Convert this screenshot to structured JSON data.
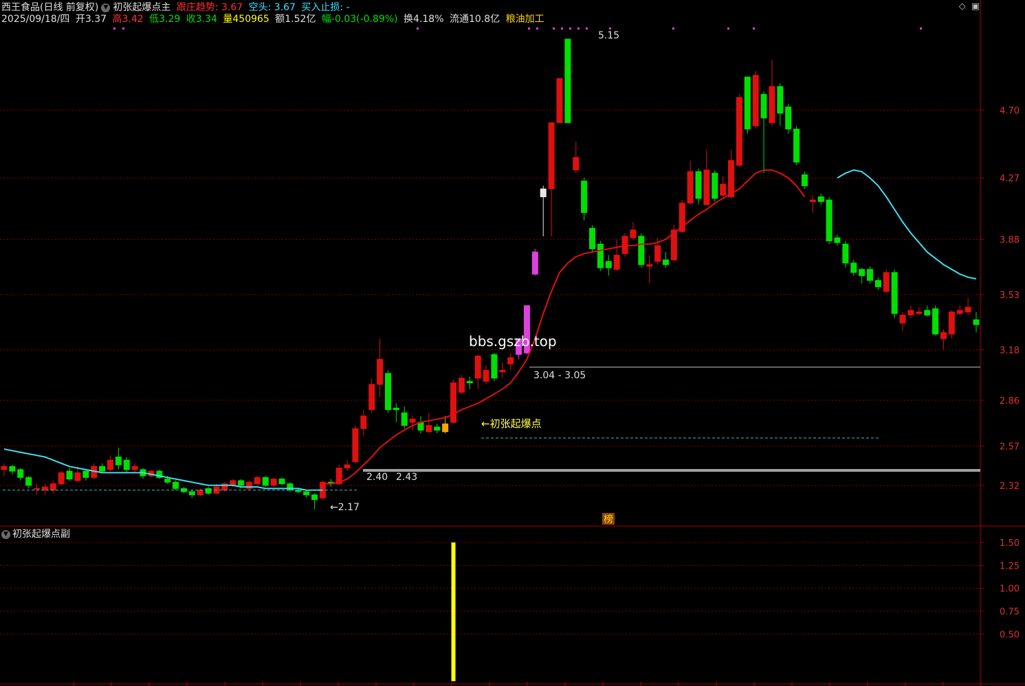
{
  "header": {
    "stock": "西王食品(日线 前复权)",
    "indicator": "初张起爆点主",
    "trend_label": "跟庄趋势: 3.67",
    "short_label": "空头: 3.67",
    "stop_label": "买入止损: -",
    "date": "2025/09/18/四",
    "open": "开3.37",
    "high": "高3.42",
    "low": "低3.29",
    "close": "收3.34",
    "volume": "量450965",
    "amount": "额1.52亿",
    "change": "幅-0.03(-0.89%)",
    "turnover": "换4.18%",
    "float": "流通10.8亿",
    "sector": "粮油加工"
  },
  "sub_panel": {
    "title": "初张起爆点副"
  },
  "colors": {
    "up": "#e01010",
    "down": "#00e000",
    "ma_cyan": "#40e0f0",
    "ma_red": "#e01010",
    "grid": "#8b0000",
    "signal": "#ffff00"
  },
  "chart_data": [
    {
      "type": "candlestick",
      "y_ticks": [
        "4.70",
        "4.27",
        "3.88",
        "3.53",
        "3.18",
        "2.86",
        "2.57",
        "2.32"
      ],
      "ylim": [
        2.05,
        5.25
      ],
      "annotations": {
        "watermark_site": "bbs.gszb.top",
        "peak_label": "5.15",
        "low_label": "←2.17",
        "range_label": "3.04 - 3.05",
        "band_left": "2.40",
        "band_right": "2.43",
        "signal_label": "←初张起爆点",
        "badge": "榜"
      },
      "candles": [
        {
          "o": 2.42,
          "c": 2.44,
          "h": 2.46,
          "l": 2.38
        },
        {
          "o": 2.44,
          "c": 2.41,
          "h": 2.45,
          "l": 2.39
        },
        {
          "o": 2.42,
          "c": 2.37,
          "h": 2.43,
          "l": 2.35
        },
        {
          "o": 2.37,
          "c": 2.32,
          "h": 2.38,
          "l": 2.3
        },
        {
          "o": 2.3,
          "c": 2.3,
          "h": 2.33,
          "l": 2.26
        },
        {
          "o": 2.29,
          "c": 2.31,
          "h": 2.33,
          "l": 2.26
        },
        {
          "o": 2.29,
          "c": 2.33,
          "h": 2.35,
          "l": 2.27
        },
        {
          "o": 2.33,
          "c": 2.4,
          "h": 2.41,
          "l": 2.32
        },
        {
          "o": 2.41,
          "c": 2.36,
          "h": 2.43,
          "l": 2.35
        },
        {
          "o": 2.35,
          "c": 2.4,
          "h": 2.44,
          "l": 2.34
        },
        {
          "o": 2.41,
          "c": 2.37,
          "h": 2.42,
          "l": 2.35
        },
        {
          "o": 2.37,
          "c": 2.44,
          "h": 2.46,
          "l": 2.36
        },
        {
          "o": 2.44,
          "c": 2.41,
          "h": 2.46,
          "l": 2.4
        },
        {
          "o": 2.42,
          "c": 2.48,
          "h": 2.51,
          "l": 2.41
        },
        {
          "o": 2.5,
          "c": 2.45,
          "h": 2.56,
          "l": 2.42
        },
        {
          "o": 2.48,
          "c": 2.42,
          "h": 2.5,
          "l": 2.4
        },
        {
          "o": 2.42,
          "c": 2.44,
          "h": 2.46,
          "l": 2.4
        },
        {
          "o": 2.42,
          "c": 2.38,
          "h": 2.43,
          "l": 2.36
        },
        {
          "o": 2.38,
          "c": 2.41,
          "h": 2.42,
          "l": 2.37
        },
        {
          "o": 2.41,
          "c": 2.37,
          "h": 2.42,
          "l": 2.36
        },
        {
          "o": 2.36,
          "c": 2.34,
          "h": 2.38,
          "l": 2.33
        },
        {
          "o": 2.34,
          "c": 2.3,
          "h": 2.35,
          "l": 2.29
        },
        {
          "o": 2.3,
          "c": 2.28,
          "h": 2.31,
          "l": 2.27
        },
        {
          "o": 2.28,
          "c": 2.26,
          "h": 2.29,
          "l": 2.24
        },
        {
          "o": 2.26,
          "c": 2.29,
          "h": 2.3,
          "l": 2.25
        },
        {
          "o": 2.3,
          "c": 2.27,
          "h": 2.31,
          "l": 2.26
        },
        {
          "o": 2.27,
          "c": 2.31,
          "h": 2.33,
          "l": 2.26
        },
        {
          "o": 2.29,
          "c": 2.33,
          "h": 2.34,
          "l": 2.28
        },
        {
          "o": 2.32,
          "c": 2.35,
          "h": 2.36,
          "l": 2.31
        },
        {
          "o": 2.35,
          "c": 2.32,
          "h": 2.36,
          "l": 2.3
        },
        {
          "o": 2.3,
          "c": 2.34,
          "h": 2.35,
          "l": 2.29
        },
        {
          "o": 2.33,
          "c": 2.37,
          "h": 2.38,
          "l": 2.32
        },
        {
          "o": 2.37,
          "c": 2.32,
          "h": 2.38,
          "l": 2.31
        },
        {
          "o": 2.32,
          "c": 2.36,
          "h": 2.37,
          "l": 2.31
        },
        {
          "o": 2.36,
          "c": 2.33,
          "h": 2.37,
          "l": 2.32
        },
        {
          "o": 2.33,
          "c": 2.29,
          "h": 2.34,
          "l": 2.28
        },
        {
          "o": 2.29,
          "c": 2.28,
          "h": 2.3,
          "l": 2.27
        },
        {
          "o": 2.28,
          "c": 2.26,
          "h": 2.29,
          "l": 2.24
        },
        {
          "o": 2.26,
          "c": 2.23,
          "h": 2.27,
          "l": 2.17
        },
        {
          "o": 2.24,
          "c": 2.34,
          "h": 2.35,
          "l": 2.23
        },
        {
          "o": 2.34,
          "c": 2.33,
          "h": 2.36,
          "l": 2.31
        },
        {
          "o": 2.33,
          "c": 2.43,
          "h": 2.45,
          "l": 2.32
        },
        {
          "o": 2.43,
          "c": 2.45,
          "h": 2.48,
          "l": 2.41
        },
        {
          "o": 2.47,
          "c": 2.68,
          "h": 2.7,
          "l": 2.46
        },
        {
          "o": 2.68,
          "c": 2.76,
          "h": 2.8,
          "l": 2.63
        },
        {
          "o": 2.8,
          "c": 2.96,
          "h": 3.0,
          "l": 2.78
        },
        {
          "o": 2.96,
          "c": 3.12,
          "h": 3.25,
          "l": 2.88
        },
        {
          "o": 3.03,
          "c": 2.8,
          "h": 3.05,
          "l": 2.78
        },
        {
          "o": 2.81,
          "c": 2.8,
          "h": 2.84,
          "l": 2.72
        },
        {
          "o": 2.78,
          "c": 2.7,
          "h": 2.82,
          "l": 2.68
        },
        {
          "o": 2.72,
          "c": 2.74,
          "h": 2.76,
          "l": 2.67
        },
        {
          "o": 2.72,
          "c": 2.67,
          "h": 2.76,
          "l": 2.65
        },
        {
          "o": 2.66,
          "c": 2.7,
          "h": 2.78,
          "l": 2.65
        },
        {
          "o": 2.69,
          "c": 2.67,
          "h": 2.71,
          "l": 2.65
        },
        {
          "o": 2.66,
          "c": 2.71,
          "h": 2.76,
          "l": 2.65
        },
        {
          "o": 2.72,
          "c": 2.97,
          "h": 2.99,
          "l": 2.71
        },
        {
          "o": 2.91,
          "c": 3.0,
          "h": 3.02,
          "l": 2.9
        },
        {
          "o": 2.98,
          "c": 2.97,
          "h": 3.01,
          "l": 2.93
        },
        {
          "o": 3.0,
          "c": 3.14,
          "h": 3.15,
          "l": 2.93
        },
        {
          "o": 2.98,
          "c": 3.05,
          "h": 3.08,
          "l": 2.96
        },
        {
          "o": 3.15,
          "c": 3.0,
          "h": 3.16,
          "l": 2.98
        },
        {
          "o": 3.04,
          "c": 3.05,
          "h": 3.1,
          "l": 3.0
        },
        {
          "o": 3.09,
          "c": 3.13,
          "h": 3.16,
          "l": 3.05
        },
        {
          "o": 3.15,
          "c": 3.25,
          "h": 3.25,
          "l": 3.12
        },
        {
          "o": 3.16,
          "c": 3.46,
          "h": 3.46,
          "l": 3.15
        },
        {
          "o": 3.8,
          "c": 3.66,
          "h": 3.82,
          "l": 3.65
        },
        {
          "o": 4.15,
          "c": 4.2,
          "h": 4.22,
          "l": 3.9
        },
        {
          "o": 4.2,
          "c": 4.62,
          "h": 4.62,
          "l": 3.9
        },
        {
          "o": 4.62,
          "c": 4.9,
          "h": 4.9,
          "l": 4.62
        },
        {
          "o": 5.15,
          "c": 4.62,
          "h": 5.15,
          "l": 4.62
        },
        {
          "o": 4.32,
          "c": 4.4,
          "h": 4.5,
          "l": 4.3
        },
        {
          "o": 4.25,
          "c": 4.05,
          "h": 4.27,
          "l": 4.0
        },
        {
          "o": 3.95,
          "c": 3.82,
          "h": 3.97,
          "l": 3.8
        },
        {
          "o": 3.85,
          "c": 3.7,
          "h": 3.87,
          "l": 3.68
        },
        {
          "o": 3.74,
          "c": 3.7,
          "h": 3.78,
          "l": 3.65
        },
        {
          "o": 3.69,
          "c": 3.78,
          "h": 3.88,
          "l": 3.68
        },
        {
          "o": 3.79,
          "c": 3.9,
          "h": 3.92,
          "l": 3.77
        },
        {
          "o": 3.89,
          "c": 3.94,
          "h": 3.99,
          "l": 3.88
        },
        {
          "o": 3.9,
          "c": 3.72,
          "h": 3.92,
          "l": 3.7
        },
        {
          "o": 3.71,
          "c": 3.72,
          "h": 3.78,
          "l": 3.6
        },
        {
          "o": 3.74,
          "c": 3.84,
          "h": 3.89,
          "l": 3.72
        },
        {
          "o": 3.75,
          "c": 3.72,
          "h": 3.8,
          "l": 3.7
        },
        {
          "o": 3.75,
          "c": 3.94,
          "h": 3.97,
          "l": 3.74
        },
        {
          "o": 3.93,
          "c": 4.11,
          "h": 4.13,
          "l": 3.92
        },
        {
          "o": 4.11,
          "c": 4.31,
          "h": 4.38,
          "l": 4.1
        },
        {
          "o": 4.31,
          "c": 4.14,
          "h": 4.33,
          "l": 4.1
        },
        {
          "o": 4.1,
          "c": 4.32,
          "h": 4.45,
          "l": 4.1
        },
        {
          "o": 4.3,
          "c": 4.14,
          "h": 4.32,
          "l": 4.12
        },
        {
          "o": 4.16,
          "c": 4.23,
          "h": 4.28,
          "l": 4.15
        },
        {
          "o": 4.15,
          "c": 4.38,
          "h": 4.45,
          "l": 4.14
        },
        {
          "o": 4.35,
          "c": 4.78,
          "h": 4.8,
          "l": 4.34
        },
        {
          "o": 4.91,
          "c": 4.58,
          "h": 4.91,
          "l": 4.55
        },
        {
          "o": 4.6,
          "c": 4.92,
          "h": 4.95,
          "l": 4.58
        },
        {
          "o": 4.8,
          "c": 4.65,
          "h": 4.82,
          "l": 4.3
        },
        {
          "o": 4.62,
          "c": 4.85,
          "h": 5.02,
          "l": 4.6
        },
        {
          "o": 4.85,
          "c": 4.68,
          "h": 4.87,
          "l": 4.6
        },
        {
          "o": 4.72,
          "c": 4.58,
          "h": 4.74,
          "l": 4.55
        },
        {
          "o": 4.58,
          "c": 4.37,
          "h": 4.6,
          "l": 4.35
        },
        {
          "o": 4.29,
          "c": 4.22,
          "h": 4.31,
          "l": 4.2
        },
        {
          "o": 4.12,
          "c": 4.13,
          "h": 4.16,
          "l": 4.05
        },
        {
          "o": 4.15,
          "c": 4.12,
          "h": 4.17,
          "l": 4.1
        },
        {
          "o": 4.13,
          "c": 3.87,
          "h": 4.15,
          "l": 3.85
        },
        {
          "o": 3.89,
          "c": 3.86,
          "h": 3.91,
          "l": 3.84
        },
        {
          "o": 3.85,
          "c": 3.73,
          "h": 3.87,
          "l": 3.7
        },
        {
          "o": 3.73,
          "c": 3.67,
          "h": 3.75,
          "l": 3.65
        },
        {
          "o": 3.69,
          "c": 3.65,
          "h": 3.7,
          "l": 3.6
        },
        {
          "o": 3.69,
          "c": 3.62,
          "h": 3.71,
          "l": 3.6
        },
        {
          "o": 3.62,
          "c": 3.58,
          "h": 3.64,
          "l": 3.56
        },
        {
          "o": 3.55,
          "c": 3.67,
          "h": 3.69,
          "l": 3.54
        },
        {
          "o": 3.67,
          "c": 3.41,
          "h": 3.69,
          "l": 3.38
        },
        {
          "o": 3.35,
          "c": 3.4,
          "h": 3.42,
          "l": 3.3
        },
        {
          "o": 3.4,
          "c": 3.43,
          "h": 3.46,
          "l": 3.38
        },
        {
          "o": 3.41,
          "c": 3.42,
          "h": 3.45,
          "l": 3.4
        },
        {
          "o": 3.43,
          "c": 3.4,
          "h": 3.46,
          "l": 3.39
        },
        {
          "o": 3.44,
          "c": 3.28,
          "h": 3.46,
          "l": 3.27
        },
        {
          "o": 3.25,
          "c": 3.29,
          "h": 3.31,
          "l": 3.18
        },
        {
          "o": 3.28,
          "c": 3.42,
          "h": 3.43,
          "l": 3.25
        },
        {
          "o": 3.41,
          "c": 3.43,
          "h": 3.46,
          "l": 3.4
        },
        {
          "o": 3.42,
          "c": 3.45,
          "h": 3.51,
          "l": 3.4
        },
        {
          "o": 3.37,
          "c": 3.34,
          "h": 3.42,
          "l": 3.29
        }
      ],
      "ma_cyan": [
        2.55,
        2.54,
        2.53,
        2.52,
        2.51,
        2.5,
        2.48,
        2.46,
        2.44,
        2.43,
        2.42,
        2.41,
        2.4,
        2.4,
        2.4,
        2.4,
        2.4,
        2.4,
        2.39,
        2.38,
        2.37,
        2.36,
        2.35,
        2.34,
        2.33,
        2.32,
        2.32,
        2.32,
        2.32,
        2.31,
        2.31,
        2.31,
        2.3,
        2.3,
        2.3,
        2.3,
        2.3,
        2.29,
        2.29,
        2.29,
        null,
        null,
        null,
        null,
        null,
        null,
        null,
        null,
        null,
        null,
        null,
        null,
        null,
        null,
        null,
        null,
        null,
        null,
        null,
        null,
        null,
        null,
        null,
        null,
        null,
        null,
        null,
        null,
        null,
        null,
        null,
        null,
        null,
        null,
        null,
        null,
        null,
        null,
        null,
        null,
        null,
        null,
        null,
        null,
        null,
        null,
        null,
        null,
        null,
        null,
        null,
        null,
        null,
        null,
        null,
        null,
        4.27,
        4.3,
        4.32,
        4.31,
        4.27,
        4.22,
        4.15,
        4.07,
        3.99,
        3.92,
        3.86,
        3.8,
        3.76,
        3.72,
        3.69,
        3.66,
        3.64,
        3.63
      ],
      "ma_red": [
        null,
        null,
        null,
        null,
        null,
        null,
        null,
        null,
        null,
        null,
        null,
        null,
        null,
        null,
        null,
        null,
        null,
        null,
        null,
        null,
        null,
        null,
        null,
        null,
        null,
        null,
        null,
        null,
        null,
        null,
        null,
        null,
        null,
        null,
        null,
        null,
        null,
        null,
        null,
        2.33,
        2.33,
        2.34,
        2.36,
        2.4,
        2.45,
        2.5,
        2.56,
        2.6,
        2.64,
        2.67,
        2.7,
        2.72,
        2.73,
        2.74,
        2.75,
        2.77,
        2.8,
        2.82,
        2.84,
        2.87,
        2.9,
        2.93,
        2.97,
        3.04,
        3.12,
        3.25,
        3.41,
        3.55,
        3.67,
        3.73,
        3.77,
        3.79,
        3.8,
        3.81,
        3.82,
        3.83,
        3.84,
        3.84,
        3.85,
        3.85,
        3.86,
        3.88,
        3.92,
        3.96,
        4.0,
        4.04,
        4.07,
        4.11,
        4.14,
        4.17,
        4.2,
        4.25,
        4.3,
        4.32,
        4.32,
        4.3,
        4.27,
        4.22,
        4.15
      ]
    },
    {
      "type": "bar",
      "title": "初张起爆点副",
      "y_ticks": [
        "1.50",
        "1.25",
        "1.00",
        "0.75",
        "0.50"
      ],
      "ylim": [
        0.0,
        1.5
      ],
      "signal_index": 55,
      "values": [
        1.5
      ]
    }
  ]
}
